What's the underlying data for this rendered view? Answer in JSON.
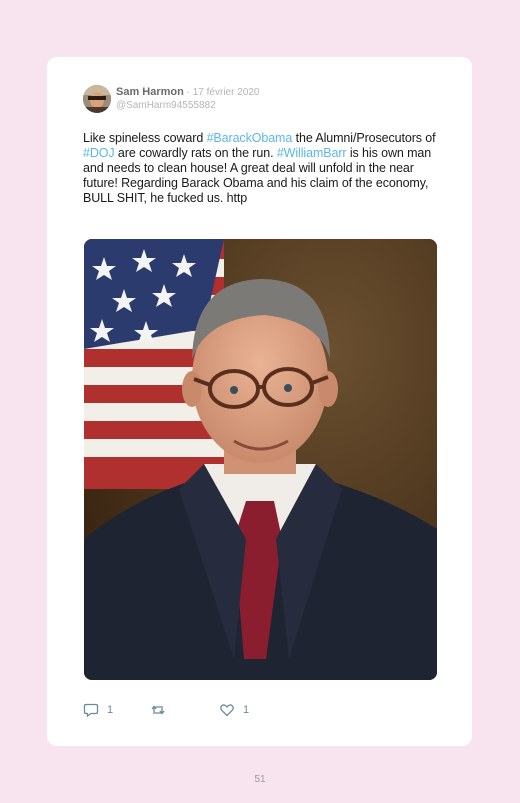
{
  "tweet": {
    "author": "Sam Harmon",
    "separator": " · ",
    "date": "17 février 2020",
    "handle": "@SamHarm94555882",
    "text": {
      "p1": "Like spineless coward ",
      "tag1": "#BarackObama",
      "p2": " the Alumni/Prosecutors of ",
      "tag2": "#DOJ",
      "p3": " are cowardly rats on the run. ",
      "tag3": "#WilliamBarr",
      "p4": " is his own man and needs to clean house! A great deal will unfold in the near future! Regarding Barack Obama and his claim of the economy, BULL SHIT, he fucked us. http"
    },
    "media": {
      "description_icon": "portrait-photo"
    },
    "actions": {
      "reply_count": "1",
      "retweet_count": "",
      "like_count": "1"
    }
  },
  "page": {
    "number": "51"
  },
  "colors": {
    "background": "#f7e4ee",
    "card": "#ffffff",
    "hashtag": "#5bb8e6",
    "icon": "#6b8a9a"
  }
}
